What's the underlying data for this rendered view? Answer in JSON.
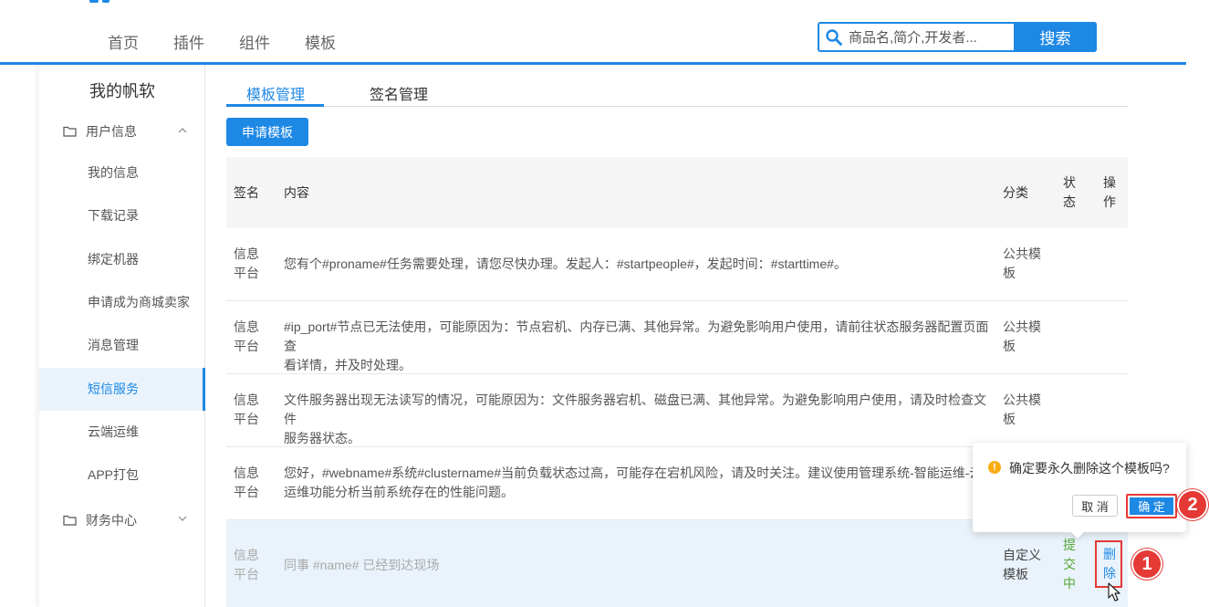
{
  "nav": {
    "items": [
      "首页",
      "插件",
      "组件",
      "模板"
    ],
    "search_placeholder": "商品名,简介,开发者...",
    "search_button": "搜索"
  },
  "sidebar": {
    "title": "我的帆软",
    "group_user": "用户信息",
    "items": [
      "我的信息",
      "下载记录",
      "绑定机器",
      "申请成为商城卖家",
      "消息管理",
      "短信服务",
      "云端运维",
      "APP打包"
    ],
    "group_finance": "财务中心",
    "active_index": 5
  },
  "tabs": [
    "模板管理",
    "签名管理"
  ],
  "apply_button": "申请模板",
  "table": {
    "headers": {
      "sign": "签名",
      "content": "内容",
      "category": "分类",
      "status_l1": "状",
      "status_l0": "状",
      "op": "操"
    },
    "header_lines": {
      "status": [
        "状",
        "态"
      ],
      "op": [
        "操",
        "作"
      ]
    },
    "rows": [
      {
        "sign": [
          "信息",
          "平台"
        ],
        "content": [
          "您有个#proname#任务需要处理，请您尽快办理。发起人：#startpeople#，发起时间：#starttime#。"
        ],
        "category": [
          "公共模",
          "板"
        ]
      },
      {
        "sign": [
          "信息",
          "平台"
        ],
        "content": [
          "#ip_port#节点已无法使用，可能原因为：节点宕机、内存已满、其他异常。为避免影响用户使用，请前往状态服务器配置页面查",
          "看详情，并及时处理。"
        ],
        "category": [
          "公共模",
          "板"
        ]
      },
      {
        "sign": [
          "信息",
          "平台"
        ],
        "content": [
          "文件服务器出现无法读写的情况，可能原因为：文件服务器宕机、磁盘已满、其他异常。为避免影响用户使用，请及时检查文件",
          "服务器状态。"
        ],
        "category": [
          "公共模",
          "板"
        ]
      },
      {
        "sign": [
          "信息",
          "平台"
        ],
        "content": [
          "您好，#webname#系统#clustername#当前负载状态过高，可能存在宕机风险，请及时关注。建议使用管理系统-智能运维-云",
          "运维功能分析当前系统存在的性能问题。"
        ],
        "category": [
          "公共模",
          "板"
        ]
      },
      {
        "sign": [
          "信息",
          "平台"
        ],
        "content": [
          "同事 #name# 已经到达现场"
        ],
        "category": [
          "自定义",
          "模板"
        ],
        "status": [
          "提",
          "交",
          "中"
        ],
        "op": [
          "删",
          "除"
        ]
      }
    ]
  },
  "popconfirm": {
    "message": "确定要永久删除这个模板吗?",
    "cancel": "取 消",
    "ok": "确 定"
  },
  "annotations": [
    "1",
    "2"
  ],
  "colors": {
    "accent": "#1e88e5",
    "annotation": "#e53935",
    "status_pending": "#52a634",
    "warning": "#faad14"
  }
}
